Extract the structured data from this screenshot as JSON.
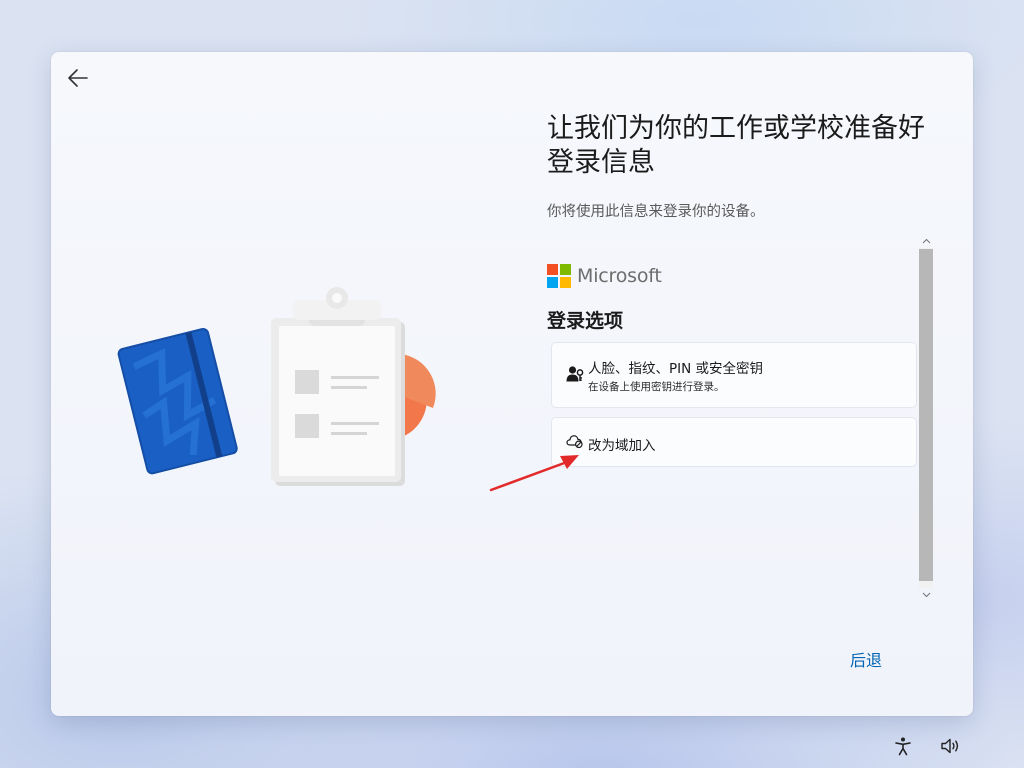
{
  "page": {
    "title": "让我们为你的工作或学校准备好登录信息",
    "subtitle": "你将使用此信息来登录你的设备。"
  },
  "microsoft": {
    "wordmark": "Microsoft",
    "colors": [
      "#f25022",
      "#7fba00",
      "#00a4ef",
      "#ffb900"
    ]
  },
  "sign_in": {
    "section_title": "登录选项",
    "options": [
      {
        "title": "人脸、指纹、PIN 或安全密钥",
        "description": "在设备上使用密钥进行登录。",
        "icon": "person-key-icon"
      },
      {
        "title": "改为域加入",
        "icon": "cloud-blocked-icon"
      }
    ]
  },
  "footer": {
    "back_label": "后退"
  },
  "colors": {
    "accent": "#0064b4",
    "annotation_arrow": "#e22a2a"
  },
  "tray": {
    "icons": [
      "accessibility-icon",
      "volume-icon"
    ]
  }
}
